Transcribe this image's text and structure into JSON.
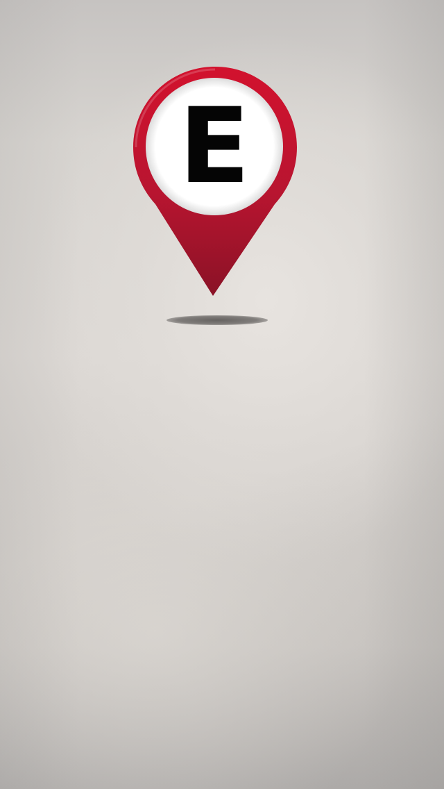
{
  "splash": {
    "logo": {
      "letter": "E",
      "icon": "map-pin-icon",
      "colors": {
        "pin": "#c8102e",
        "pin_dark": "#8e1428",
        "circle": "#ffffff",
        "letter": "#050505"
      }
    }
  }
}
